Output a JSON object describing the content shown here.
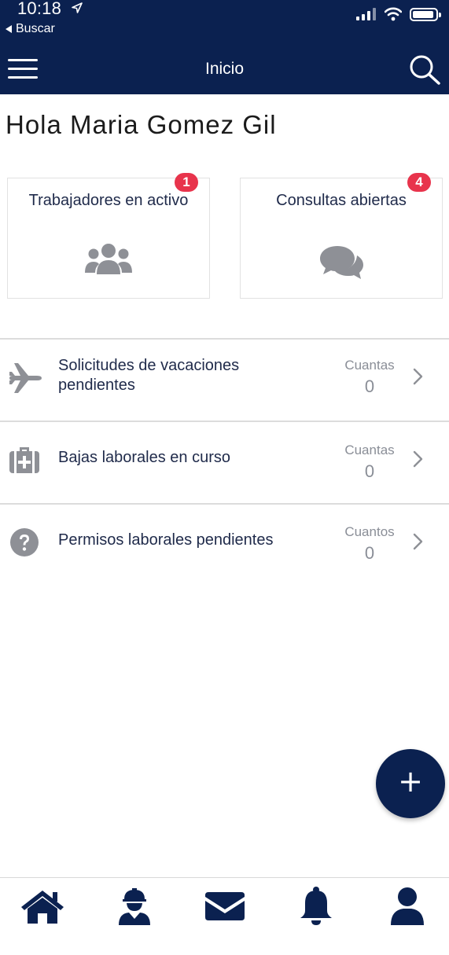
{
  "status_bar": {
    "time": "10:18",
    "back_label": "Buscar"
  },
  "header": {
    "title": "Inicio",
    "menu_icon": "hamburger-menu-icon",
    "search_icon": "search-icon"
  },
  "greeting": "Hola Maria Gomez Gil",
  "cards": [
    {
      "title": "Trabajadores en activo",
      "badge": "1",
      "icon": "users-group-icon"
    },
    {
      "title": "Consultas abiertas",
      "badge": "4",
      "icon": "chat-bubbles-icon"
    }
  ],
  "list": [
    {
      "label_line1": "Solicitudes de vacaciones",
      "label_line2": "pendientes",
      "count_label": "Cuantas",
      "count_value": "0",
      "icon": "airplane-icon"
    },
    {
      "label_line1": "Bajas laborales en curso",
      "label_line2": "",
      "count_label": "Cuantas",
      "count_value": "0",
      "icon": "medical-kit-icon"
    },
    {
      "label_line1": "Permisos laborales pendientes",
      "label_line2": "",
      "count_label": "Cuantos",
      "count_value": "0",
      "icon": "question-circle-icon"
    }
  ],
  "fab": {
    "label": "+"
  },
  "bottom_nav": [
    {
      "name": "home",
      "icon": "home-icon"
    },
    {
      "name": "workers",
      "icon": "worker-helmet-icon"
    },
    {
      "name": "messages",
      "icon": "envelope-icon"
    },
    {
      "name": "notifications",
      "icon": "bell-icon"
    },
    {
      "name": "profile",
      "icon": "user-icon"
    }
  ],
  "colors": {
    "primary": "#0b2150",
    "badge": "#e8344c",
    "icon_gray": "#8e9096"
  }
}
